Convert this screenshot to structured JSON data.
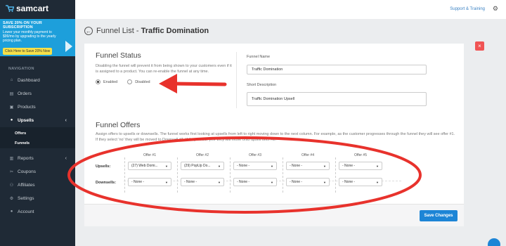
{
  "brand": {
    "name": "samcart"
  },
  "promo": {
    "title": "SAVE 20% ON YOUR SUBSCRIPTION",
    "text": "Lower your monthly payment to $99/mo by upgrading to the yearly pricing plan.",
    "button": "Click Here to Save 20% Now"
  },
  "sidebar": {
    "heading": "NAVIGATION",
    "items": [
      {
        "label": "Dashboard",
        "icon": "home-icon"
      },
      {
        "label": "Orders",
        "icon": "orders-icon"
      },
      {
        "label": "Products",
        "icon": "products-icon"
      },
      {
        "label": "Upsells",
        "icon": "upsells-icon",
        "chevron": "‹"
      },
      {
        "label": "Reports",
        "icon": "reports-icon",
        "chevron": "‹"
      },
      {
        "label": "Coupons",
        "icon": "coupons-icon"
      },
      {
        "label": "Affiliates",
        "icon": "affiliates-icon"
      },
      {
        "label": "Settings",
        "icon": "settings-icon"
      },
      {
        "label": "Account",
        "icon": "account-icon"
      }
    ],
    "subitems": [
      "Offers",
      "Funnels"
    ]
  },
  "topbar": {
    "support": "Support & Training"
  },
  "page": {
    "title_prefix": "Funnel List - ",
    "title_name": "Traffic Domination"
  },
  "funnel_status": {
    "title": "Funnel Status",
    "description": "Disabling the funnel will prevent it from being shown to your customers even if it is assigned to a product. You can re-enable the funnel at any time.",
    "enabled": "Enabled",
    "disabled": "Disabled",
    "selected": "Enabled"
  },
  "funnel_name": {
    "label": "Funnel Name",
    "value": "Traffic Domination"
  },
  "short_description": {
    "label": "Short Description",
    "value": "Traffic Domination Upsell"
  },
  "funnel_offers": {
    "title": "Funnel Offers",
    "description": "Assign offers to upsells or downsells. The funnel works first looking at upsells from left to right moving down to the next column. For example, as the customer progresses through the funnel they will see offer #1. If they select 'no' they will be moved to Downsell #1. If they select 'yes' they will move onto upsell offer #2.",
    "headers": [
      "Offer #1",
      "Offer #2",
      "Offer #3",
      "Offer #4",
      "Offer #5"
    ],
    "upsells_label": "Upsells:",
    "downsells_label": "Downsells:",
    "upsells": [
      "(27) Web Domi...",
      "(29) PopUp Do...",
      "- None -",
      "- None -",
      "- None -"
    ],
    "downsells": [
      "- None -",
      "- None -",
      "- None -",
      "- None -",
      "- None -"
    ]
  },
  "actions": {
    "save": "Save Changes",
    "close": "×"
  },
  "colors": {
    "sidebar": "#1f2a36",
    "accent": "#1d85d6",
    "promo": "#1d9fdb",
    "annotation": "#e8322c"
  }
}
